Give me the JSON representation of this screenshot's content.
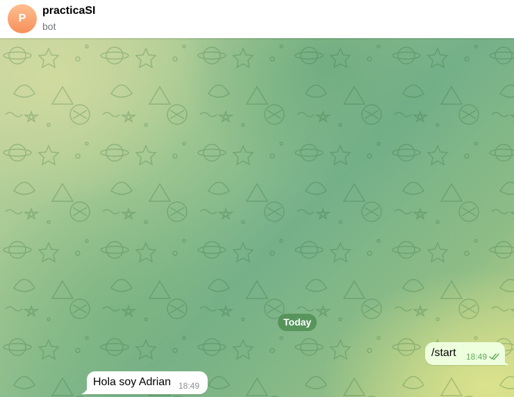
{
  "header": {
    "avatar_letter": "P",
    "title": "practicaSI",
    "subtitle": "bot"
  },
  "chat": {
    "date_separator": "Today",
    "messages": [
      {
        "direction": "outgoing",
        "text": "/start",
        "time": "18:49",
        "status_icon": "double-check-icon"
      },
      {
        "direction": "incoming",
        "text": "Hola soy Adrian",
        "time": "18:49"
      }
    ]
  },
  "colors": {
    "avatar_gradient": [
      "#ffbf90",
      "#f6905a"
    ],
    "outgoing_bubble": "#eeffde",
    "incoming_bubble": "#ffffff",
    "outgoing_meta": "#5fa85c",
    "date_pill": "#4a894e"
  }
}
